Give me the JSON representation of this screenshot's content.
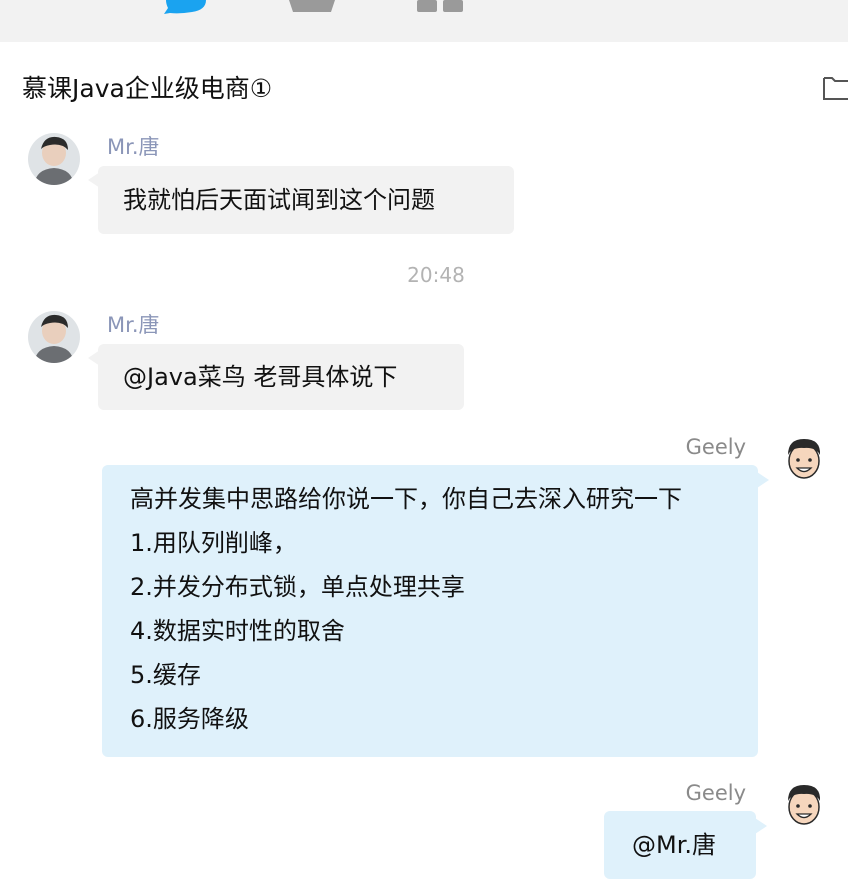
{
  "window": {
    "toolbar_icons": [
      "chat-bubble-icon",
      "contact-person-icon",
      "apps-grid-icon",
      "folder-icon"
    ],
    "accent_color": "#1aa3f0"
  },
  "chat": {
    "title": "慕课Java企业级电商①"
  },
  "messages": [
    {
      "sender": "Mr.唐",
      "side": "left",
      "lines": [
        "我就怕后天面试闻到这个问题"
      ]
    },
    {
      "timestamp": "20:48"
    },
    {
      "sender": "Mr.唐",
      "side": "left",
      "lines": [
        "@Java菜鸟 老哥具体说下"
      ]
    },
    {
      "sender": "Geely",
      "side": "right",
      "lines": [
        "高并发集中思路给你说一下，你自己去深入研究一下",
        "1.用队列削峰，",
        "2.并发分布式锁，单点处理共享",
        "4.数据实时性的取舍",
        "5.缓存",
        "6.服务降级"
      ]
    },
    {
      "sender": "Geely",
      "side": "right",
      "lines": [
        "@Mr.唐"
      ]
    }
  ]
}
